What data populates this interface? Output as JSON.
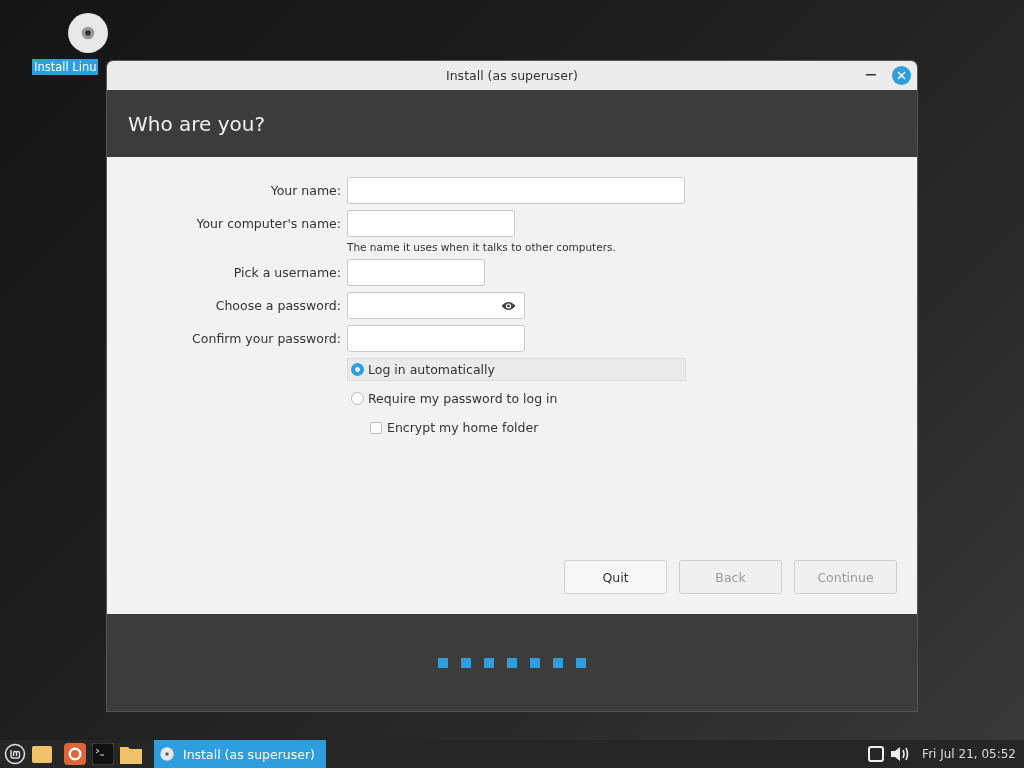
{
  "desktop_icon": {
    "label": "Install Linu"
  },
  "window": {
    "title": "Install (as superuser)",
    "heading": "Who are you?"
  },
  "form": {
    "fields": [
      {
        "label": "Your name:",
        "kind": "text"
      },
      {
        "label": "Your computer's name:",
        "kind": "text",
        "note": "The name it uses when it talks to other computers."
      },
      {
        "label": "Pick a username:",
        "kind": "text"
      },
      {
        "label": "Choose a password:",
        "kind": "password"
      },
      {
        "label": "Confirm your password:",
        "kind": "text"
      }
    ],
    "login_options": [
      {
        "label": "Log in automatically",
        "selected": true
      },
      {
        "label": "Require my password to log in",
        "selected": false
      }
    ],
    "encrypt": {
      "label": "Encrypt my home folder",
      "checked": false
    }
  },
  "buttons": [
    {
      "label": "Quit",
      "disabled": false
    },
    {
      "label": "Back",
      "disabled": true
    },
    {
      "label": "Continue",
      "disabled": true
    }
  ],
  "progress_steps": [
    {
      "done": true
    },
    {
      "done": true
    },
    {
      "done": true
    },
    {
      "done": true
    },
    {
      "done": true
    },
    {
      "done": true
    },
    {
      "done": true
    }
  ],
  "taskbar": {
    "task": {
      "label": "Install (as superuser)",
      "selected": true
    },
    "clock": "Fri Jul 21, 05:52"
  }
}
